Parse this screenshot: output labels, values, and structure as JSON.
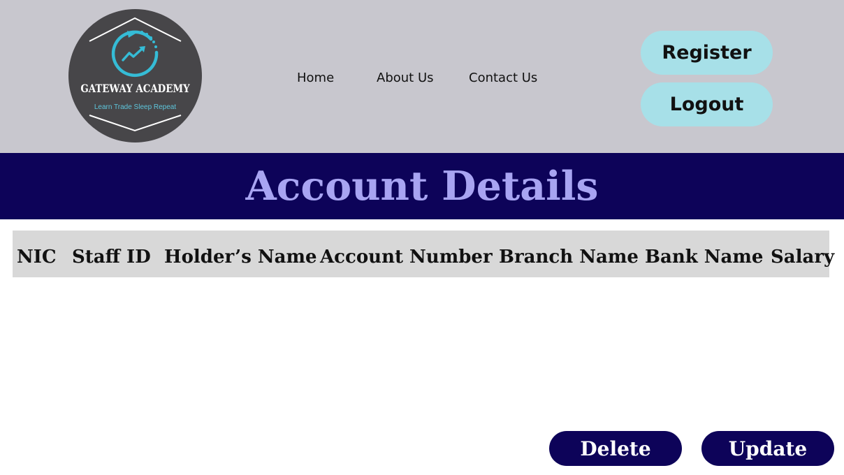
{
  "logo": {
    "name": "GATEWAY ACADEMY",
    "tagline": "Learn Trade Sleep Repeat"
  },
  "nav": {
    "home": "Home",
    "about": "About Us",
    "contact": "Contact Us"
  },
  "auth": {
    "register_label": "Register",
    "logout_label": "Logout"
  },
  "page": {
    "title": "Account Details"
  },
  "table": {
    "columns": [
      "NIC",
      "Staff ID",
      "Holder’s Name",
      "Account Number",
      "Branch Name",
      "Bank Name",
      "Salary"
    ]
  },
  "actions": {
    "delete_label": "Delete",
    "update_label": "Update"
  },
  "colors": {
    "header_bg": "#c8c7ce",
    "banner_bg": "#0d0359",
    "banner_text": "#a8a4f2",
    "pill_bg": "#a7e0e8",
    "action_bg": "#0d0359",
    "table_header_bg": "#d8d8d8",
    "logo_accent": "#35bcd6"
  }
}
